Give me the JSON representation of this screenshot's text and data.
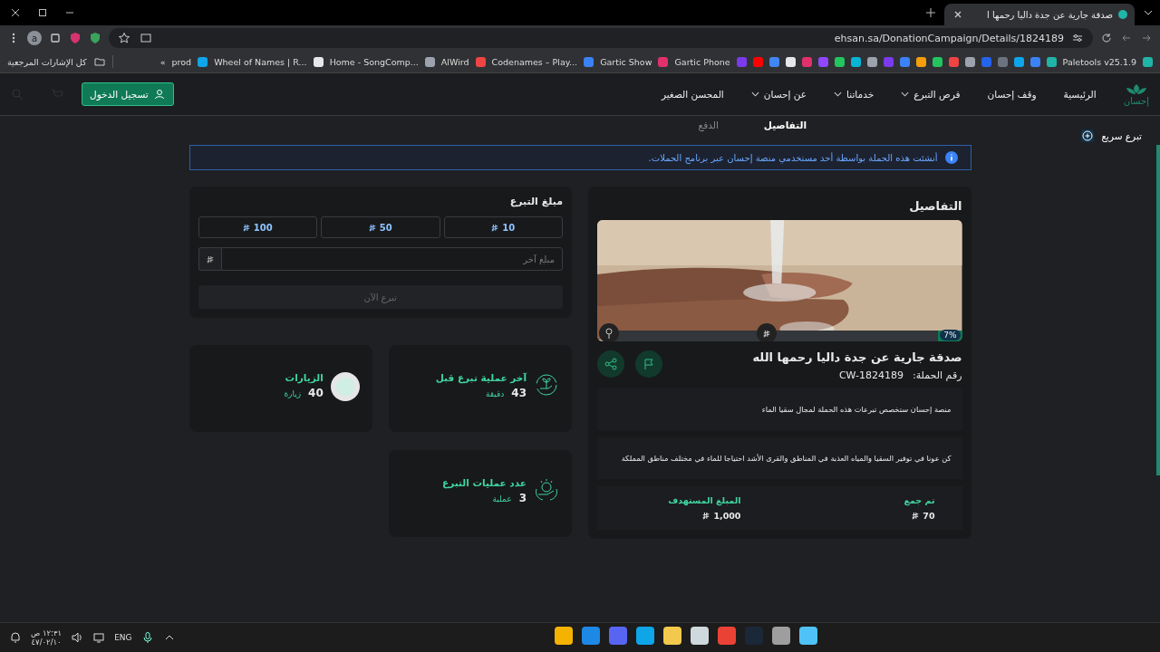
{
  "browser": {
    "tab": {
      "title": "صدقة جارية عن جدة داليا رحمها ا",
      "selected": true
    },
    "profile": "a",
    "address": "ehsan.sa/DonationCampaign/Details/1824189",
    "bookmarks": {
      "items": [
        {
          "label": "Paletools v25.1.9",
          "kind": "label"
        },
        {
          "kind": "icons"
        },
        {
          "label": "Gartic Phone",
          "kind": "label"
        },
        {
          "label": "Gartic Show",
          "kind": "label"
        },
        {
          "label": "Codenames – Play...",
          "kind": "label"
        },
        {
          "label": "AlWird",
          "kind": "label"
        },
        {
          "label": "Home - SongComp...",
          "kind": "label"
        },
        {
          "label": "Wheel of Names | R...",
          "kind": "label"
        },
        {
          "label": "prod",
          "kind": "label"
        }
      ],
      "more": "»",
      "all": "كل الإشارات المرجعية"
    }
  },
  "nav": {
    "logo": "إحسان",
    "items": [
      {
        "label": "الرئيسية",
        "dropdown": false
      },
      {
        "label": "وقف إحسان",
        "dropdown": false
      },
      {
        "label": "فرص التبرع",
        "dropdown": true
      },
      {
        "label": "خدماتنا",
        "dropdown": true
      },
      {
        "label": "عن إحسان",
        "dropdown": true
      },
      {
        "label": "المحسن الصغير",
        "dropdown": false
      }
    ],
    "login": "تسجيل الدخول"
  },
  "page_tabs": [
    {
      "label": "التفاصيل",
      "selected": true
    },
    {
      "label": "الدفع",
      "selected": false
    }
  ],
  "quick_donate": "تبرع سريع",
  "notice": "أنشئت هذه الحملة بواسطة أحد مستخدمي منصة إحسان عبر برنامج الحملات.",
  "donation": {
    "title": "مبلغ التبرع",
    "amounts": [
      "10",
      "50",
      "100"
    ],
    "other_placeholder": "مبلغ آخر",
    "submit": {
      "label": "تبرع الآن",
      "disabled": true
    }
  },
  "stats": [
    {
      "kind": "last",
      "title": "آخر عملية تبرع قبل",
      "value": "43",
      "unit": "دقيقة"
    },
    {
      "kind": "visits",
      "title": "الزيارات",
      "value": "40",
      "unit": "زيارة"
    },
    {
      "kind": "count",
      "title": "عدد عمليات التبرع",
      "value": "3",
      "unit": "عملية"
    }
  ],
  "details": {
    "title": "التفاصيل",
    "progress": {
      "level": 0.07,
      "label": "7%"
    },
    "campaign_title": "صدقة جارية عن جدة داليا رحمها الله",
    "number_label": "رقم الحملة:",
    "number": "CW-1824189",
    "notes": [
      "منصة إحسان ستخصص تبرعات هذه الحملة لمجال سقيا الماء",
      "كن عونا في توفير السقيا والمياه العذبة في المناطق والقرى الأشد احتياجا للماء في مختلف مناطق المملكة"
    ],
    "collected": {
      "label": "تم جمع",
      "amount": "70"
    },
    "target": {
      "label": "المبلغ المستهدف",
      "amount": "1,000"
    }
  },
  "taskbar": {
    "time": "١٢:٣١ ص",
    "date": "٤٧/٠٢/١٠",
    "language": "ENG"
  }
}
